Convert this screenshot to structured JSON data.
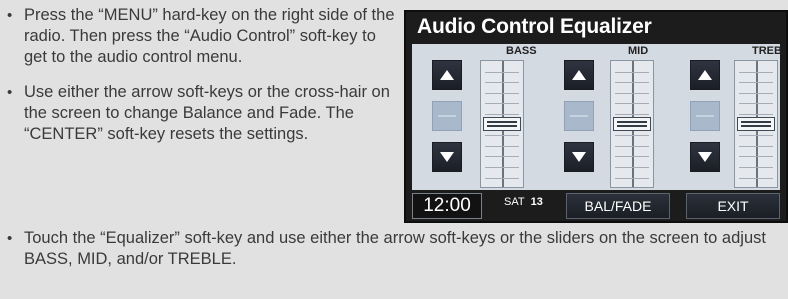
{
  "instructions_top": [
    "Press the “MENU” hard-key on the right side of the radio. Then press the “Audio Control” soft-key to get to the audio control menu.",
    "Use either the arrow soft-keys or the cross-hair on the screen to change Balance and Fade. The “CENTER” soft-key resets the settings."
  ],
  "instructions_bottom": [
    "Touch the “Equalizer” soft-key and use either the arrow soft-keys or the sliders on the screen to adjust BASS, MID, and/or TREBLE."
  ],
  "radio": {
    "title": "Audio Control Equalizer",
    "bands": [
      {
        "label": "BASS",
        "level": 0
      },
      {
        "label": "MID",
        "level": 0
      },
      {
        "label": "TREB",
        "level": 0
      }
    ],
    "status": {
      "clock": "12:00",
      "band": "SAT",
      "channel": "13",
      "balfade_label": "BAL/FADE",
      "exit_label": "EXIT"
    }
  },
  "icons": {
    "up": "triangle-up-icon",
    "down": "triangle-down-icon",
    "center": "dash-icon"
  },
  "colors": {
    "page_bg": "#e1e1e1",
    "screen_bg": "#1c1c1c",
    "eq_panel_bg": "#d4dae2",
    "button_bg": "#232831"
  }
}
